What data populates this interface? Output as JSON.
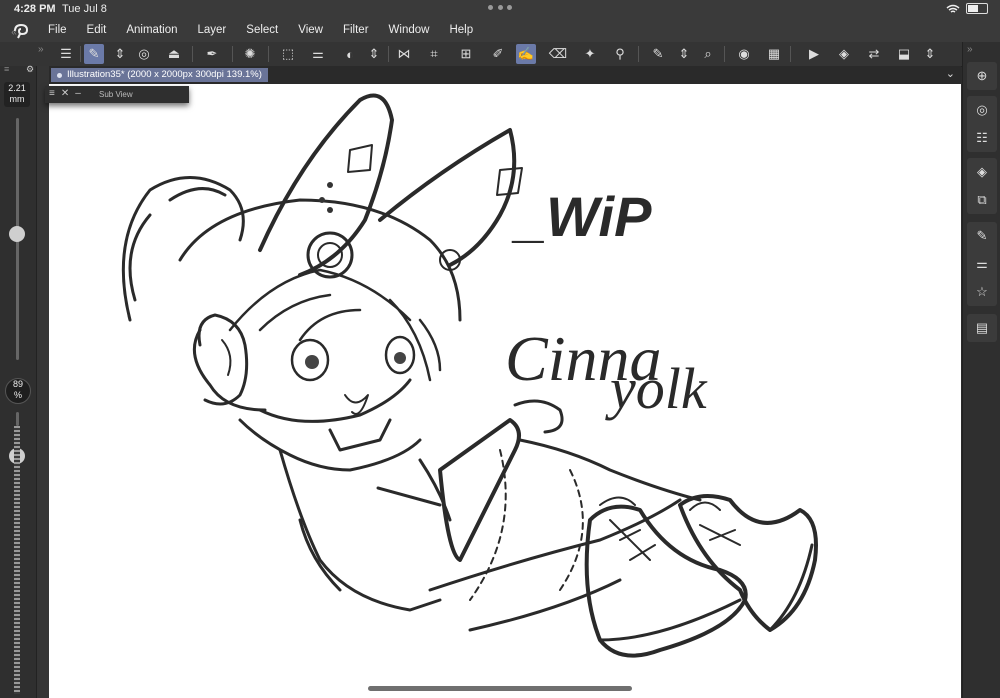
{
  "status": {
    "time": "4:28 PM",
    "date": "Tue Jul 8"
  },
  "menu": {
    "items": [
      "File",
      "Edit",
      "Animation",
      "Layer",
      "Select",
      "View",
      "Filter",
      "Window",
      "Help"
    ]
  },
  "tab": {
    "title": "Illustration35* (2000 x 2000px 300dpi 139.1%)"
  },
  "subview": {
    "title": "Sub View"
  },
  "brush": {
    "size_value": "2.21",
    "size_unit": "mm",
    "opacity_value": "89",
    "opacity_unit": "%",
    "size_level": 0.52,
    "opacity_level": 0.1
  },
  "canvas": {
    "text_wip": "_WiP",
    "text_name1": "Cinna",
    "text_name2": "yolk"
  },
  "toolbar_icons": [
    "menu-icon",
    "selected-tool-icon",
    "swap-icon",
    "color-icon",
    "fill-icon",
    "pen-icon",
    "loading-icon",
    "transform-icon",
    "adjust-icon",
    "rotate-icon",
    "swap-v-icon",
    "flip-icon",
    "crop-icon",
    "grid-icon",
    "ruler-icon",
    "pen-active-icon",
    "eraser-icon",
    "sparkle-icon",
    "eyedropper-icon",
    "edit-icon",
    "swap2-icon",
    "zoom-icon",
    "circle-icon",
    "layers-icon",
    "animation-icon",
    "stack-icon",
    "transfer-icon",
    "export-icon",
    "expand-icon"
  ],
  "right_icons": [
    "navigator-icon",
    "sub-tool-icon",
    "tool-property-icon",
    "layer-icon",
    "layer-property-icon",
    "brush-size-icon",
    "adjust-panel-icon",
    "material-icon",
    "timeline-icon"
  ]
}
